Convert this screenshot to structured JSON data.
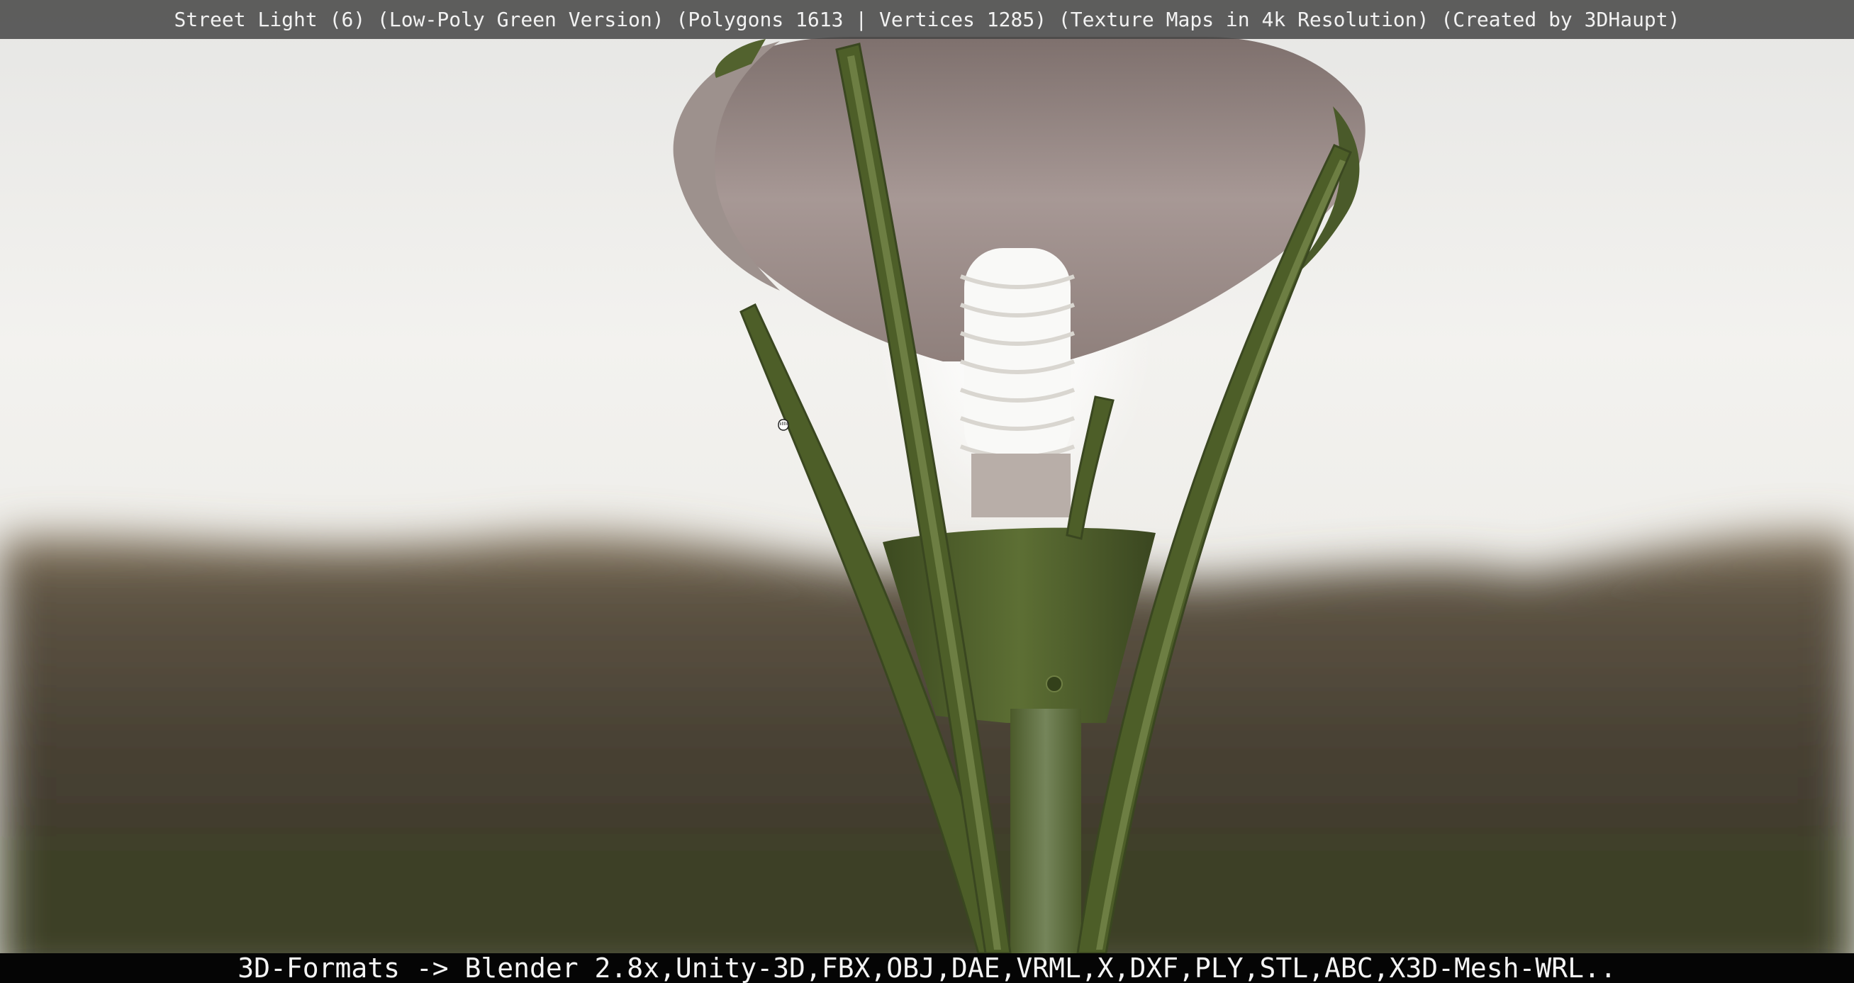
{
  "viewer": {
    "title": "Street Light (6) (Low-Poly Green Version) (Polygons 1613 | Vertices 1285) (Texture Maps in 4k Resolution) (Created by 3DHaupt)",
    "formats": "3D-Formats -> Blender 2.8x,Unity-3D,FBX,OBJ,DAE,VRML,X,DXF,PLY,STL,ABC,X3D-Mesh-WRL..",
    "cursor_icon": "grab-hand-icon"
  },
  "colors": {
    "sky": "#f2f1ee",
    "ground": "#4a4436",
    "lamp_green": "#4f5f2c",
    "shade_inner": "#9a8c86",
    "bulb_glow": "#ffffff"
  }
}
